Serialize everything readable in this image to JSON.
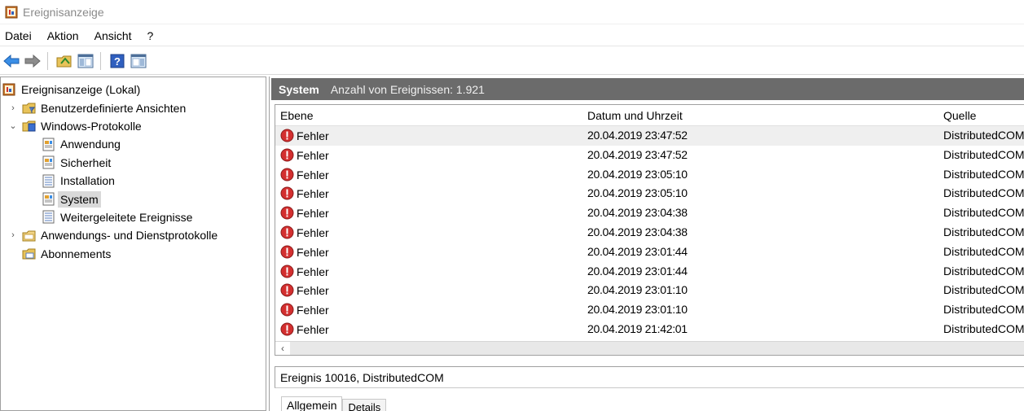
{
  "window": {
    "title": "Ereignisanzeige",
    "icon": "event-viewer-icon"
  },
  "menu": [
    "Datei",
    "Aktion",
    "Ansicht",
    "?"
  ],
  "toolbar": {
    "buttons": [
      "back-arrow-icon",
      "forward-arrow-icon",
      "up-folder-icon",
      "show-hide-console-tree-icon",
      "help-icon",
      "show-hide-action-pane-icon"
    ]
  },
  "tree": {
    "items": [
      {
        "label": "Ereignisanzeige (Lokal)",
        "icon": "event-viewer-icon",
        "indent": 0,
        "chevron": ""
      },
      {
        "label": "Benutzerdefinierte Ansichten",
        "icon": "folder-filter-icon",
        "indent": 1,
        "chevron": "›"
      },
      {
        "label": "Windows-Protokolle",
        "icon": "folder-logs-icon",
        "indent": 1,
        "chevron": "⌄"
      },
      {
        "label": "Anwendung",
        "icon": "log-icon",
        "indent": 2,
        "chevron": ""
      },
      {
        "label": "Sicherheit",
        "icon": "log-icon",
        "indent": 2,
        "chevron": ""
      },
      {
        "label": "Installation",
        "icon": "log-plain-icon",
        "indent": 2,
        "chevron": ""
      },
      {
        "label": "System",
        "icon": "log-icon",
        "indent": 2,
        "chevron": "",
        "selected": true
      },
      {
        "label": "Weitergeleitete Ereignisse",
        "icon": "log-plain-icon",
        "indent": 2,
        "chevron": ""
      },
      {
        "label": "Anwendungs- und Dienstprotokolle",
        "icon": "folder-icon",
        "indent": 1,
        "chevron": "›"
      },
      {
        "label": "Abonnements",
        "icon": "subscriptions-icon",
        "indent": 1,
        "chevron": ""
      }
    ]
  },
  "panel": {
    "name": "System",
    "count_label": "Anzahl von Ereignissen: 1.921"
  },
  "table": {
    "headers": [
      "Ebene",
      "Datum und Uhrzeit",
      "Quelle"
    ],
    "rows": [
      {
        "level": "Fehler",
        "datetime": "20.04.2019 23:47:52",
        "source": "DistributedCOM"
      },
      {
        "level": "Fehler",
        "datetime": "20.04.2019 23:47:52",
        "source": "DistributedCOM"
      },
      {
        "level": "Fehler",
        "datetime": "20.04.2019 23:05:10",
        "source": "DistributedCOM"
      },
      {
        "level": "Fehler",
        "datetime": "20.04.2019 23:05:10",
        "source": "DistributedCOM"
      },
      {
        "level": "Fehler",
        "datetime": "20.04.2019 23:04:38",
        "source": "DistributedCOM"
      },
      {
        "level": "Fehler",
        "datetime": "20.04.2019 23:04:38",
        "source": "DistributedCOM"
      },
      {
        "level": "Fehler",
        "datetime": "20.04.2019 23:01:44",
        "source": "DistributedCOM"
      },
      {
        "level": "Fehler",
        "datetime": "20.04.2019 23:01:44",
        "source": "DistributedCOM"
      },
      {
        "level": "Fehler",
        "datetime": "20.04.2019 23:01:10",
        "source": "DistributedCOM"
      },
      {
        "level": "Fehler",
        "datetime": "20.04.2019 23:01:10",
        "source": "DistributedCOM"
      },
      {
        "level": "Fehler",
        "datetime": "20.04.2019 21:42:01",
        "source": "DistributedCOM"
      }
    ]
  },
  "detail": {
    "title": "Ereignis 10016, DistributedCOM",
    "tabs": [
      "Allgemein",
      "Details"
    ]
  },
  "colors": {
    "panel_header": "#6b6b6b",
    "error_red": "#d32f2f",
    "selection": "#d9d9d9"
  }
}
